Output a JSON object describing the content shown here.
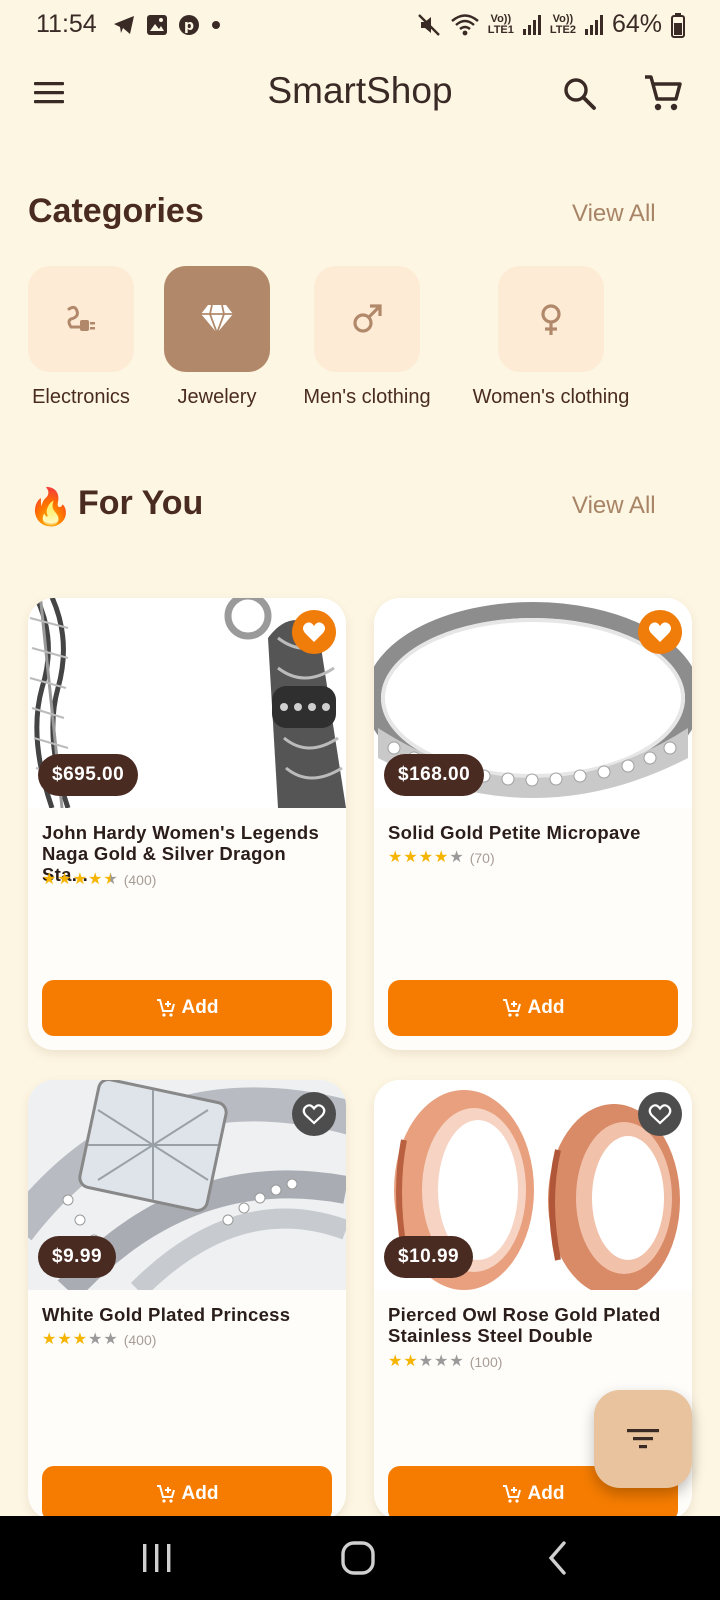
{
  "status_bar": {
    "time": "11:54",
    "battery": "64%",
    "sim1": [
      "Vo))",
      "LTE1"
    ],
    "sim2": [
      "Vo))",
      "LTE2"
    ],
    "notification_icons": [
      "telegram-icon",
      "gallery-icon",
      "pinterest-icon",
      "dot-icon"
    ]
  },
  "app_bar": {
    "title": "SmartShop"
  },
  "categories": {
    "title": "Categories",
    "view_all": "View All",
    "items": [
      {
        "label": "Electronics",
        "icon": "plug-icon",
        "selected": false
      },
      {
        "label": "Jewelery",
        "icon": "diamond-icon",
        "selected": true
      },
      {
        "label": "Men's clothing",
        "icon": "male-icon",
        "selected": false
      },
      {
        "label": "Women's clothing",
        "icon": "female-icon",
        "selected": false
      }
    ]
  },
  "for_you": {
    "emoji": "🔥",
    "title": "For You",
    "view_all": "View All"
  },
  "products": [
    {
      "price": "$695.00",
      "title": "John Hardy Women's Legends Naga Gold & Silver Dragon Sta...",
      "rating": 4.5,
      "reviews": "(400)",
      "favorite": true,
      "add_label": "Add"
    },
    {
      "price": "$168.00",
      "title": "Solid Gold Petite Micropave",
      "rating": 4,
      "reviews": "(70)",
      "favorite": true,
      "add_label": "Add"
    },
    {
      "price": "$9.99",
      "title": "White Gold Plated Princess",
      "rating": 3,
      "reviews": "(400)",
      "favorite": false,
      "add_label": "Add"
    },
    {
      "price": "$10.99",
      "title": "Pierced Owl Rose Gold Plated Stainless Steel Double",
      "rating": 2,
      "reviews": "(100)",
      "favorite": false,
      "add_label": "Add"
    }
  ],
  "colors": {
    "background": "#fdf6e3",
    "accent": "#f57c00",
    "primary_dark": "#4a2b22",
    "selected_category": "#b1896a"
  }
}
